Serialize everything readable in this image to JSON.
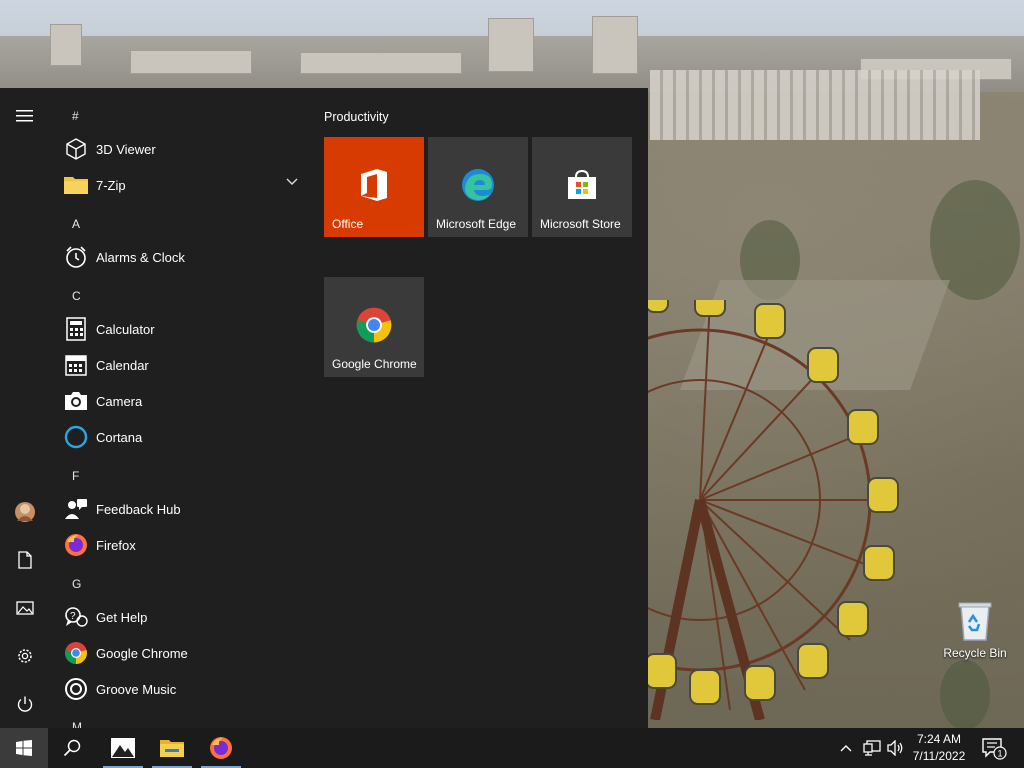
{
  "desktop": {
    "recycle_bin_label": "Recycle Bin"
  },
  "start_menu": {
    "rail": {
      "items": [
        "hamburger-icon",
        "user-avatar",
        "documents-icon",
        "pictures-icon",
        "settings-icon",
        "power-icon"
      ]
    },
    "app_list": {
      "letters": [
        "#",
        "A",
        "C",
        "F",
        "G",
        "M"
      ],
      "apps": [
        {
          "name": "3D Viewer",
          "icon": "3d-viewer-icon"
        },
        {
          "name": "7-Zip",
          "icon": "folder-icon",
          "expandable": true
        },
        {
          "name": "Alarms & Clock",
          "icon": "alarm-clock-icon"
        },
        {
          "name": "Calculator",
          "icon": "calculator-icon"
        },
        {
          "name": "Calendar",
          "icon": "calendar-icon"
        },
        {
          "name": "Camera",
          "icon": "camera-icon"
        },
        {
          "name": "Cortana",
          "icon": "cortana-icon"
        },
        {
          "name": "Feedback Hub",
          "icon": "feedback-hub-icon"
        },
        {
          "name": "Firefox",
          "icon": "firefox-icon"
        },
        {
          "name": "Get Help",
          "icon": "get-help-icon"
        },
        {
          "name": "Google Chrome",
          "icon": "chrome-icon"
        },
        {
          "name": "Groove Music",
          "icon": "groove-music-icon"
        }
      ]
    },
    "tiles": {
      "group_title": "Productivity",
      "items": [
        {
          "name": "Office",
          "icon": "office-icon",
          "color": "#d83b01"
        },
        {
          "name": "Microsoft Edge",
          "icon": "edge-icon",
          "color": "#3a3a3a"
        },
        {
          "name": "Microsoft Store",
          "icon": "store-icon",
          "color": "#3a3a3a"
        },
        {
          "name": "Google Chrome",
          "icon": "chrome-icon",
          "color": "#3a3a3a"
        }
      ]
    }
  },
  "taskbar": {
    "buttons": [
      "start-icon",
      "search-icon",
      "photos-icon",
      "file-explorer-icon",
      "firefox-icon"
    ],
    "tray_icons": [
      "chevron-up-icon",
      "network-icon",
      "volume-icon"
    ],
    "time": "7:24 AM",
    "date": "7/11/2022",
    "notification_count": "1",
    "accent_color": "#7aa7d8"
  }
}
